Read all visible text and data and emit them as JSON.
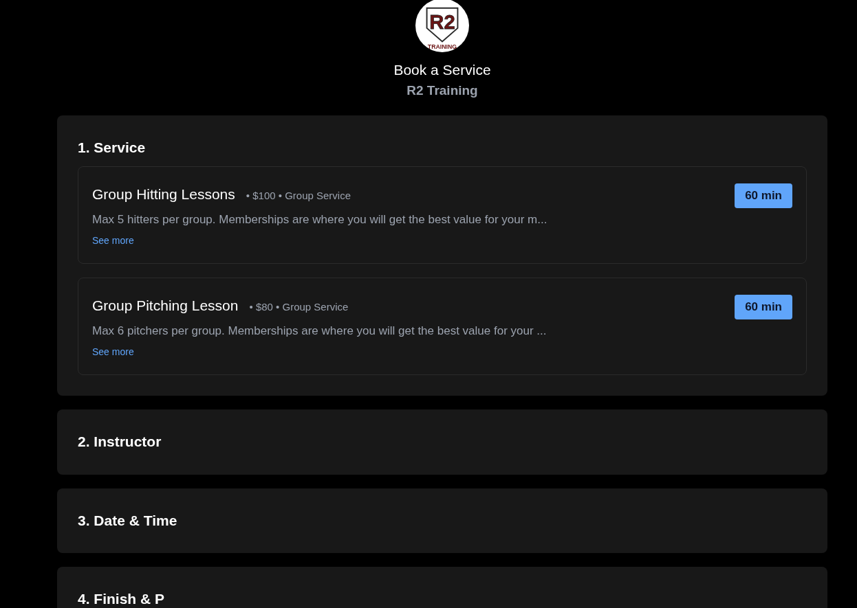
{
  "logo": {
    "mark": "R2",
    "tagline": "TRAINING"
  },
  "header": {
    "title": "Book a Service",
    "business": "R2 Training"
  },
  "sections": [
    {
      "title": "1. Service",
      "expanded": true,
      "services": [
        {
          "name": "Group Hitting Lessons",
          "price": "• $100 • Group Service",
          "description": "Max 5 hitters per group. Memberships are where you will get the best value for your m...",
          "link": "See more",
          "duration": "60 min"
        },
        {
          "name": "Group Pitching Lesson",
          "price": "• $80 • Group Service",
          "description": "Max 6 pitchers per group. Memberships are where you will get the best value for your ...",
          "link": "See more",
          "duration": "60 min"
        }
      ]
    },
    {
      "title": "2. Instructor",
      "expanded": false
    },
    {
      "title": "3. Date & Time",
      "expanded": false
    },
    {
      "title": "4. Finish & P",
      "expanded": false
    }
  ]
}
